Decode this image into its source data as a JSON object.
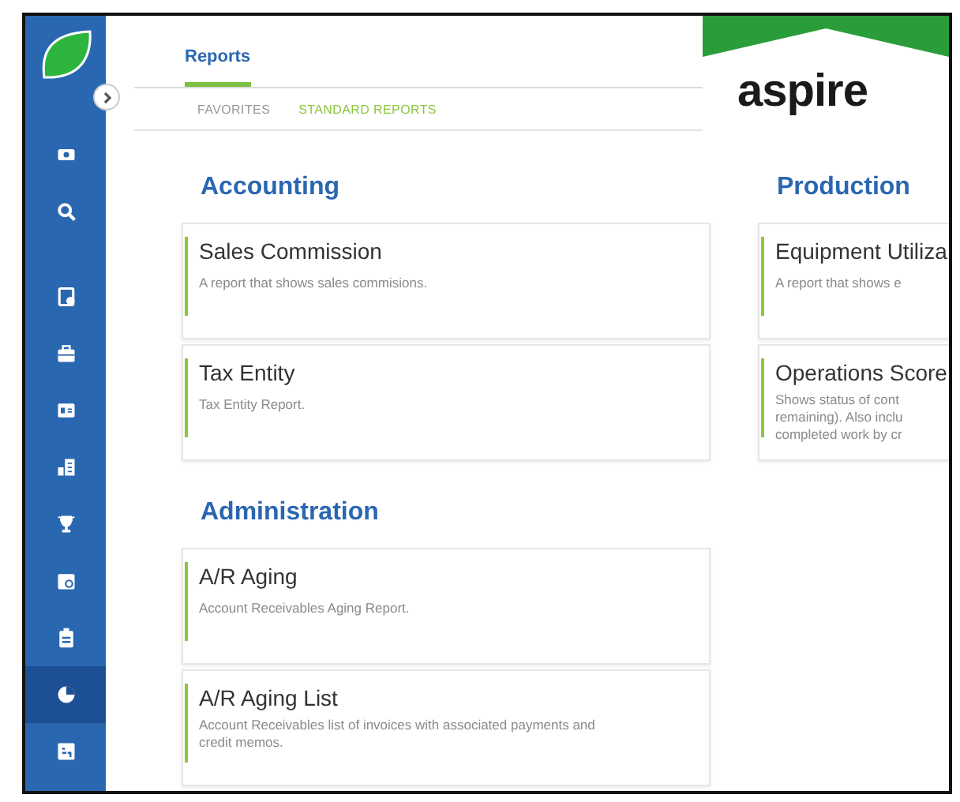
{
  "sidebar": {
    "items": [
      {
        "selected": false
      },
      {
        "selected": false
      },
      {
        "selected": false
      },
      {
        "selected": false
      },
      {
        "selected": false
      },
      {
        "selected": false
      },
      {
        "selected": false
      },
      {
        "selected": false
      },
      {
        "selected": false
      },
      {
        "selected": true
      },
      {
        "selected": false
      }
    ]
  },
  "header": {
    "tabs": [
      {
        "label": "Reports",
        "selected": true
      }
    ],
    "subtabs": [
      {
        "label": "FAVORITES",
        "selected": false
      },
      {
        "label": "STANDARD REPORTS",
        "selected": true
      }
    ]
  },
  "logo": {
    "text": "aspire"
  },
  "columns": [
    {
      "sections": [
        {
          "title": "Accounting",
          "reports": [
            {
              "title": "Sales Commission",
              "description": "A report that shows sales commisions."
            },
            {
              "title": "Tax Entity",
              "description": "Tax Entity Report."
            }
          ]
        },
        {
          "title": "Administration",
          "reports": [
            {
              "title": "A/R Aging",
              "description": "Account Receivables Aging Report."
            },
            {
              "title": "A/R Aging List",
              "description": "Account Receivables list of invoices with associated payments and credit memos."
            }
          ]
        }
      ]
    },
    {
      "sections": [
        {
          "title": "Production",
          "reports": [
            {
              "title": "Equipment Utiliza",
              "description": "A report that shows e"
            },
            {
              "title": "Operations Score",
              "description": "Shows status of cont remaining). Also inclu completed work by cr"
            }
          ]
        }
      ]
    }
  ]
}
